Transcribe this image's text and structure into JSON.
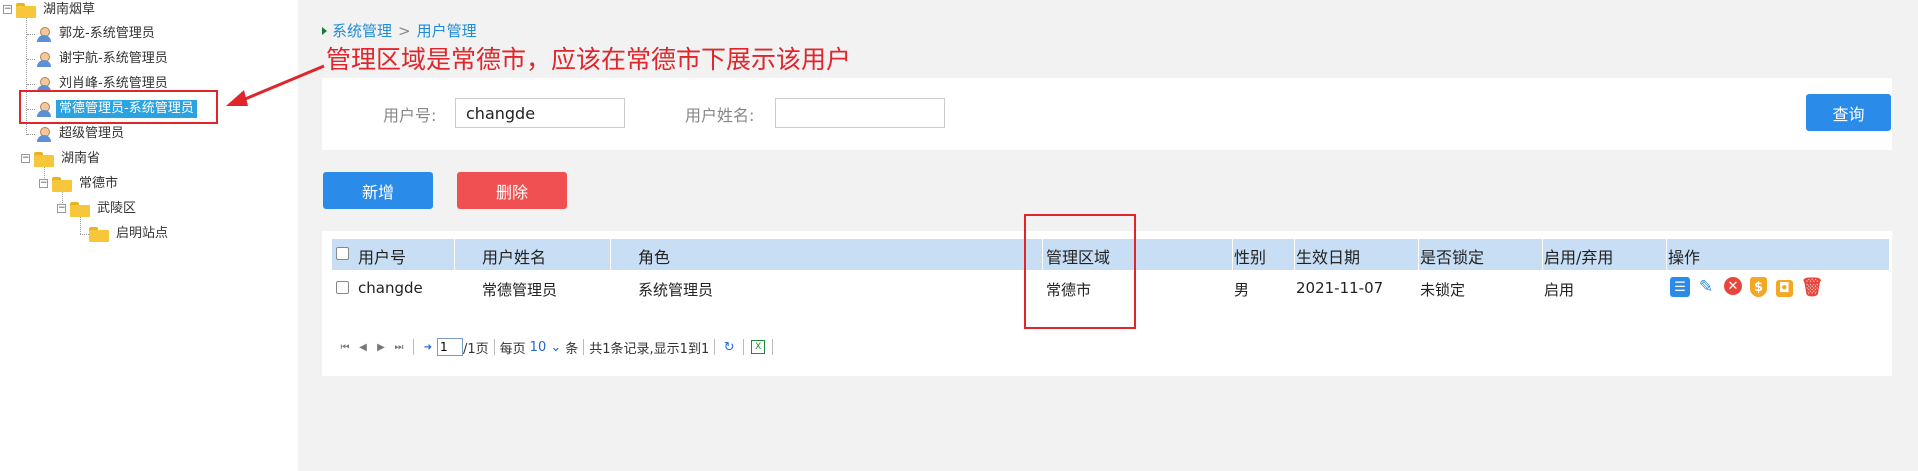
{
  "tree": {
    "root": "湖南烟草",
    "users": [
      "郭龙-系统管理员",
      "谢宇航-系统管理员",
      "刘肖峰-系统管理员",
      "常德管理员-系统管理员",
      "超级管理员"
    ],
    "province": "湖南省",
    "city": "常德市",
    "district": "武陵区",
    "station": "启明站点"
  },
  "breadcrumb": {
    "parent": "系统管理",
    "separator": ">",
    "current": "用户管理"
  },
  "annotation": "管理区域是常德市，应该在常德市下展示该用户",
  "search": {
    "user_id_label": "用户号:",
    "user_id_value": "changde",
    "user_name_label": "用户姓名:",
    "user_name_value": "",
    "query_button": "查询"
  },
  "buttons": {
    "add": "新增",
    "delete": "删除"
  },
  "table": {
    "columns": [
      "用户号",
      "用户姓名",
      "角色",
      "管理区域",
      "性别",
      "生效日期",
      "是否锁定",
      "启用/弃用",
      "操作"
    ],
    "rows": [
      [
        "changde",
        "常德管理员",
        "系统管理员",
        "常德市",
        "男",
        "2021-11-07",
        "未锁定",
        "启用"
      ]
    ]
  },
  "pager": {
    "page_value": "1",
    "total_pages": "/1页",
    "per_page_label": "每页",
    "per_page_value": "10",
    "per_page_unit": "条",
    "summary": "共1条记录,显示1到1"
  },
  "colors": {
    "accent": "#2a8ce8",
    "danger": "#f05052",
    "annotation": "#e0262b",
    "header_bg": "#c7def5",
    "selected": "#2aa3e0"
  }
}
